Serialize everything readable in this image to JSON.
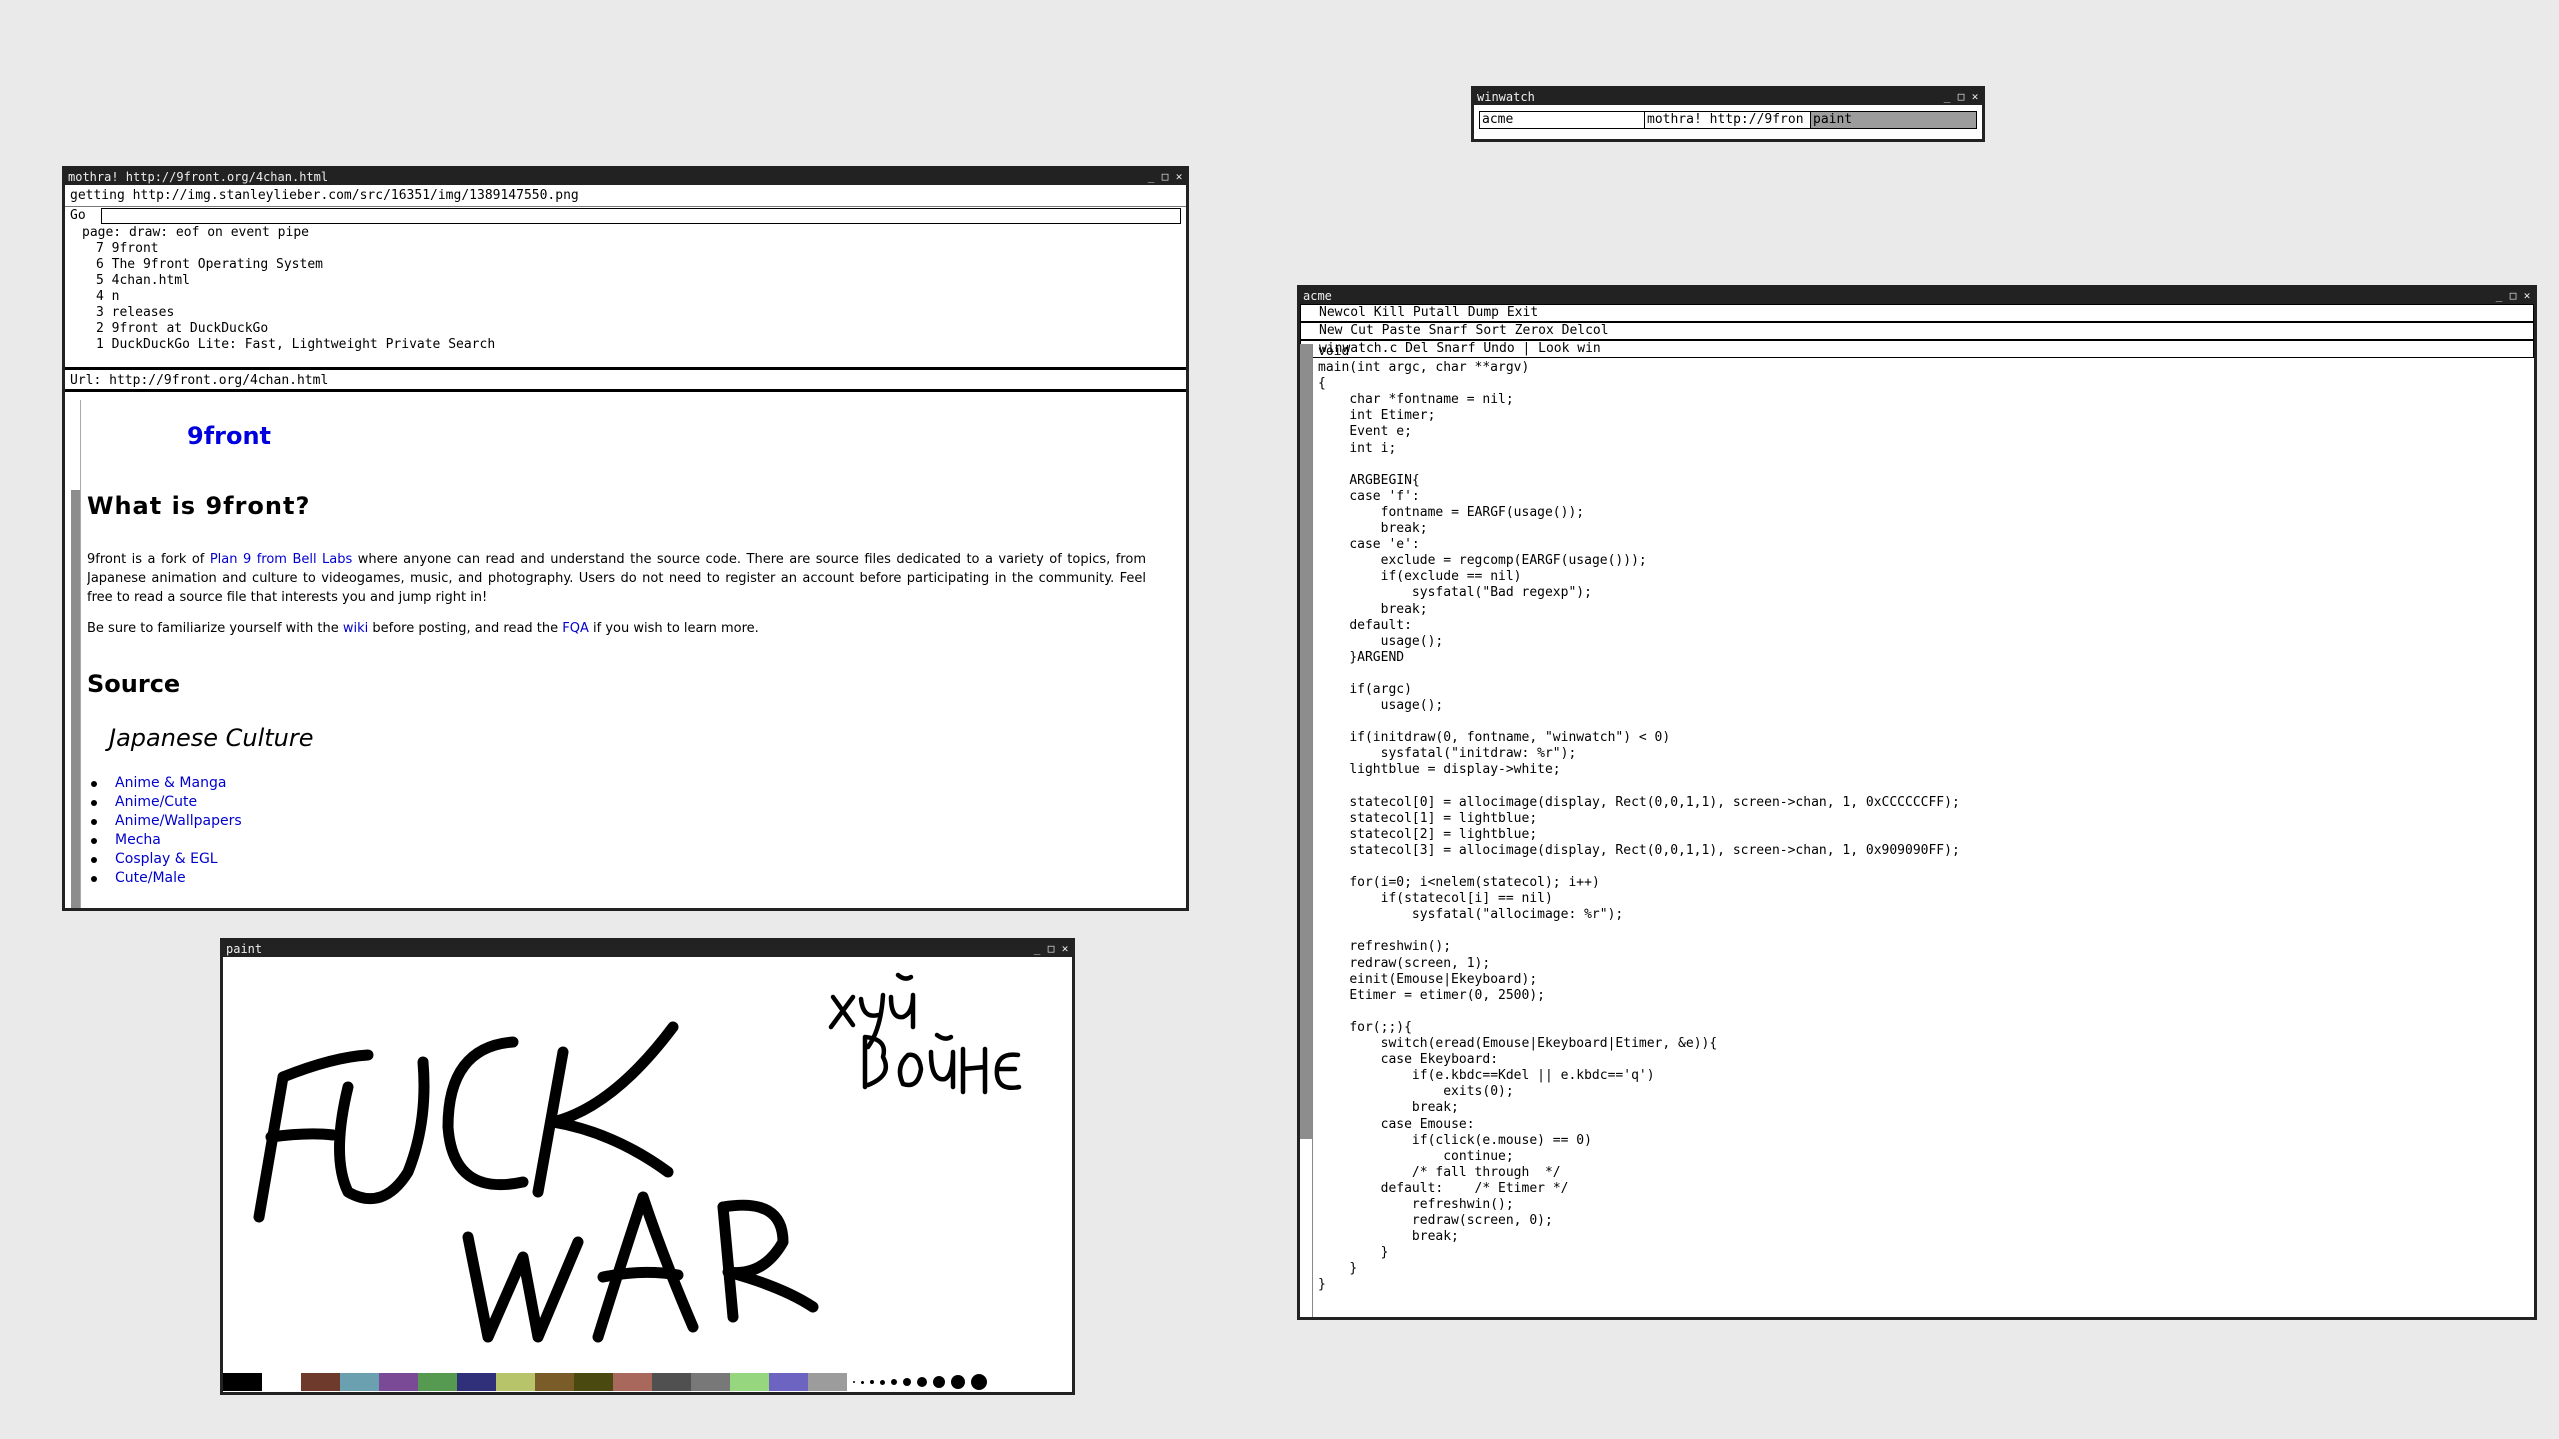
{
  "mothra": {
    "title": "mothra! http://9front.org/4chan.html",
    "status": "getting http://img.stanleylieber.com/src/16351/img/1389147550.png",
    "cmd_label": "Go",
    "cmd_value": "",
    "history_message": "page: draw: eof on event pipe",
    "history": [
      "7 9front",
      "6 The 9front Operating System",
      "5 4chan.html",
      "4 n",
      "3 releases",
      "2 9front at DuckDuckGo",
      "1 DuckDuckGo Lite: Fast, Lightweight Private Search"
    ],
    "url_label": "Url:",
    "url": "http://9front.org/4chan.html",
    "page": {
      "brand": "9front",
      "heading": "What is 9front?",
      "para1_a": "9front is a fork of ",
      "para1_link": "Plan 9 from Bell Labs",
      "para1_b": " where anyone can read and understand the source code. There are source files dedicated to a variety of topics, from Japanese animation and culture to videogames, music, and photography. Users do not need to register an account before participating in the community. Feel free to read a source file that interests you and jump right in!",
      "para2_a": "Be sure to familiarize yourself with the ",
      "para2_link1": "wiki",
      "para2_b": " before posting, and read the ",
      "para2_link2": "FQA",
      "para2_c": " if you wish to learn more.",
      "source_heading": "Source",
      "subheading": "Japanese Culture",
      "links": [
        "Anime & Manga",
        "Anime/Cute",
        "Anime/Wallpapers",
        "Mecha",
        "Cosplay & EGL",
        "Cute/Male"
      ]
    }
  },
  "winwatch": {
    "title": "winwatch",
    "cells": [
      "acme",
      "mothra! http://9fron",
      "paint"
    ]
  },
  "acme": {
    "title": "acme",
    "col_tag": "Newcol Kill Putall Dump Exit",
    "column_tag": "New Cut Paste Snarf Sort Zerox Delcol",
    "window_tag": "winwatch.c Del Snarf Undo | Look win",
    "code": "void\nmain(int argc, char **argv)\n{\n\tchar *fontname = nil;\n\tint Etimer;\n\tEvent e;\n\tint i;\n\n\tARGBEGIN{\n\tcase 'f':\n\t\tfontname = EARGF(usage());\n\t\tbreak;\n\tcase 'e':\n\t\texclude = regcomp(EARGF(usage()));\n\t\tif(exclude == nil)\n\t\t\tsysfatal(\"Bad regexp\");\n\t\tbreak;\n\tdefault:\n\t\tusage();\n\t}ARGEND\n\n\tif(argc)\n\t\tusage();\n\n\tif(initdraw(0, fontname, \"winwatch\") < 0)\n\t\tsysfatal(\"initdraw: %r\");\n\tlightblue = display->white;\n\n\tstatecol[0] = allocimage(display, Rect(0,0,1,1), screen->chan, 1, 0xCCCCCCFF);\n\tstatecol[1] = lightblue;\n\tstatecol[2] = lightblue;\n\tstatecol[3] = allocimage(display, Rect(0,0,1,1), screen->chan, 1, 0x909090FF);\n\n\tfor(i=0; i<nelem(statecol); i++)\n\t\tif(statecol[i] == nil)\n\t\t\tsysfatal(\"allocimage: %r\");\n\n\trefreshwin();\n\tredraw(screen, 1);\n\teinit(Emouse|Ekeyboard);\n\tEtimer = etimer(0, 2500);\n\n\tfor(;;){\n\t\tswitch(eread(Emouse|Ekeyboard|Etimer, &e)){\n\t\tcase Ekeyboard:\n\t\t\tif(e.kbdc==Kdel || e.kbdc=='q')\n\t\t\t\texits(0);\n\t\t\tbreak;\n\t\tcase Emouse:\n\t\t\tif(click(e.mouse) == 0)\n\t\t\t\tcontinue;\n\t\t\t/* fall through  */\n\t\tdefault:\t/* Etimer */\n\t\t\trefreshwin();\n\t\t\tredraw(screen, 0);\n\t\t\tbreak;\n\t\t}\n\t}\n}"
  },
  "paint": {
    "title": "paint",
    "drawing_text_1": "FUCK",
    "drawing_text_2": "WAR",
    "drawing_text_3": "хуй",
    "drawing_text_4": "войне",
    "palette": [
      "#000000",
      "#ffffff",
      "#6e3a2c",
      "#6aa0b0",
      "#7a4a96",
      "#559a50",
      "#2f2f7a",
      "#b8c46a",
      "#7a5c28",
      "#4a4a10",
      "#a8685c",
      "#505050",
      "#787878",
      "#96d67e",
      "#6c64c0",
      "#9c9c9c"
    ],
    "brush_sizes": [
      1,
      2,
      3,
      4,
      5,
      7,
      9,
      11,
      13,
      15
    ]
  }
}
